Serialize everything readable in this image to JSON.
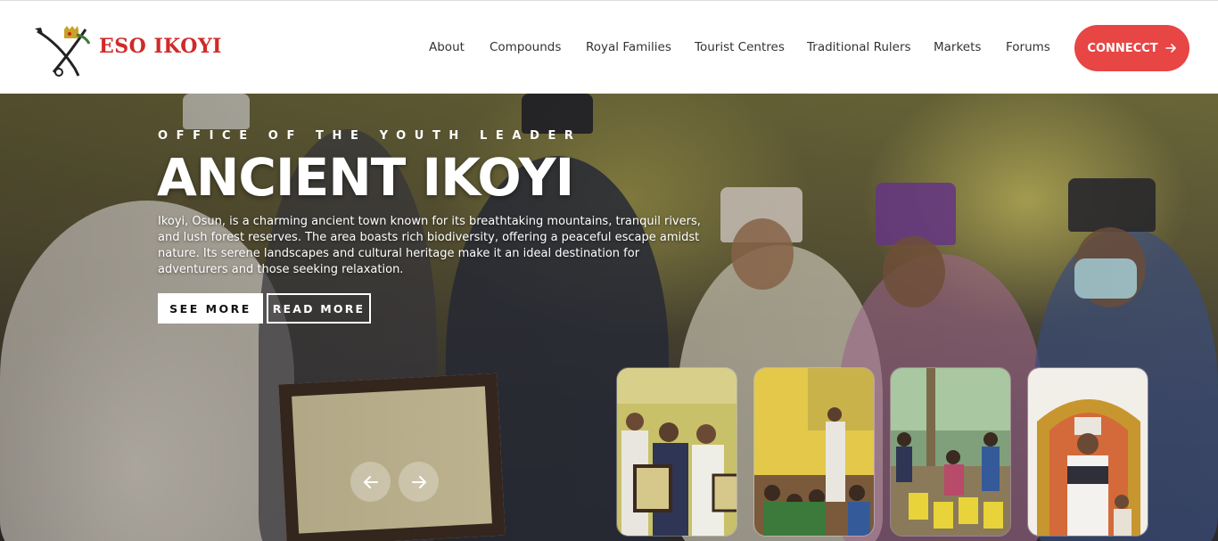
{
  "brand": {
    "name": "ESO IKOYI",
    "logo_icon": "crossed-swords-crown-logo",
    "color": "#d12a2a"
  },
  "nav": {
    "items": [
      {
        "label": "About"
      },
      {
        "label": "Compounds"
      },
      {
        "label": "Royal Families"
      },
      {
        "label": "Tourist Centres"
      },
      {
        "label": "Traditional Rulers"
      },
      {
        "label": "Markets"
      },
      {
        "label": "Forums"
      }
    ],
    "connect_label": "CONNECCT",
    "connect_icon": "arrow-right-icon",
    "connect_color": "#e84545"
  },
  "hero": {
    "eyebrow": "OFFICE OF THE YOUTH LEADER",
    "title": "ANCIENT IKOYI",
    "description": "Ikoyi, Osun, is a charming ancient town known for its breathtaking mountains, tranquil rivers, and lush forest reserves. The area boasts rich biodiversity, offering a peaceful escape amidst nature. Its serene landscapes and cultural heritage make it an ideal destination for adventurers and those seeking relaxation.",
    "see_more_label": "SEE MORE",
    "read_more_label": "READ MORE",
    "prev_icon": "arrow-left-icon",
    "next_icon": "arrow-right-icon"
  },
  "thumbnails": [
    {
      "subject": "award-presentation-photo"
    },
    {
      "subject": "classroom-visit-photo"
    },
    {
      "subject": "water-distribution-photo"
    },
    {
      "subject": "royal-throne-photo"
    }
  ]
}
